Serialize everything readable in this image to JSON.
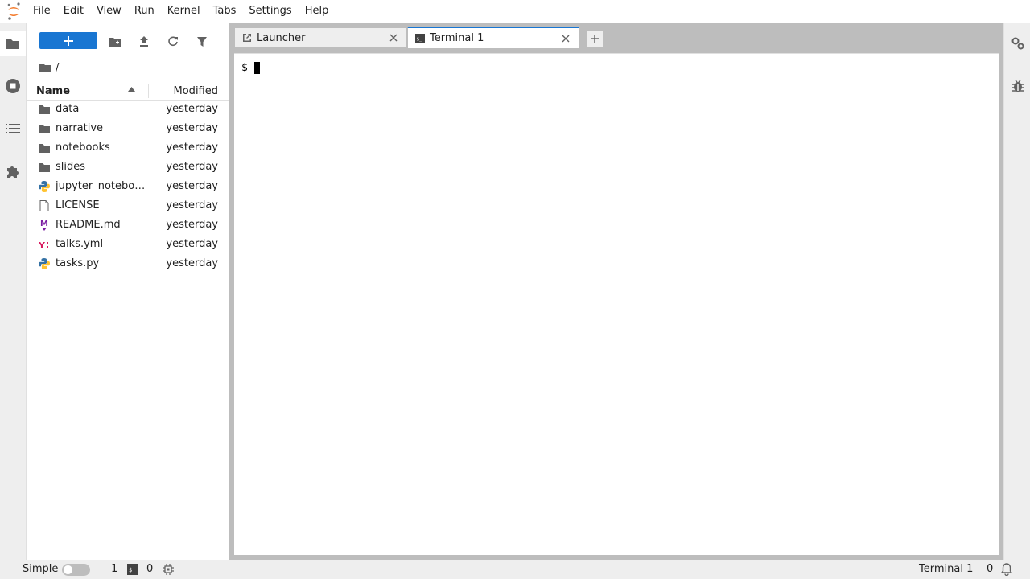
{
  "menubar": {
    "items": [
      "File",
      "Edit",
      "View",
      "Run",
      "Kernel",
      "Tabs",
      "Settings",
      "Help"
    ]
  },
  "filebrowser": {
    "breadcrumb": "/",
    "columns": {
      "name": "Name",
      "modified": "Modified"
    },
    "files": [
      {
        "name": "data",
        "icon": "folder-icon",
        "modified": "yesterday"
      },
      {
        "name": "narrative",
        "icon": "folder-icon",
        "modified": "yesterday"
      },
      {
        "name": "notebooks",
        "icon": "folder-icon",
        "modified": "yesterday"
      },
      {
        "name": "slides",
        "icon": "folder-icon",
        "modified": "yesterday"
      },
      {
        "name": "jupyter_notebo…",
        "icon": "python-file-icon",
        "modified": "yesterday"
      },
      {
        "name": "LICENSE",
        "icon": "text-file-icon",
        "modified": "yesterday"
      },
      {
        "name": "README.md",
        "icon": "markdown-file-icon",
        "modified": "yesterday"
      },
      {
        "name": "talks.yml",
        "icon": "yaml-file-icon",
        "modified": "yesterday"
      },
      {
        "name": "tasks.py",
        "icon": "python-file-icon",
        "modified": "yesterday"
      }
    ]
  },
  "tabs": [
    {
      "label": "Launcher",
      "icon": "launcher-icon",
      "active": false
    },
    {
      "label": "Terminal 1",
      "icon": "terminal-icon",
      "active": true
    }
  ],
  "terminal": {
    "prompt": "$"
  },
  "statusbar": {
    "simple_label": "Simple",
    "terminals_count": "1",
    "kernels_count": "0",
    "current_activity": "Terminal 1",
    "notifications_count": "0"
  },
  "colors": {
    "accent": "#1976d2",
    "panel_bg": "#eeeeee",
    "dock_bg": "#bdbdbd"
  }
}
